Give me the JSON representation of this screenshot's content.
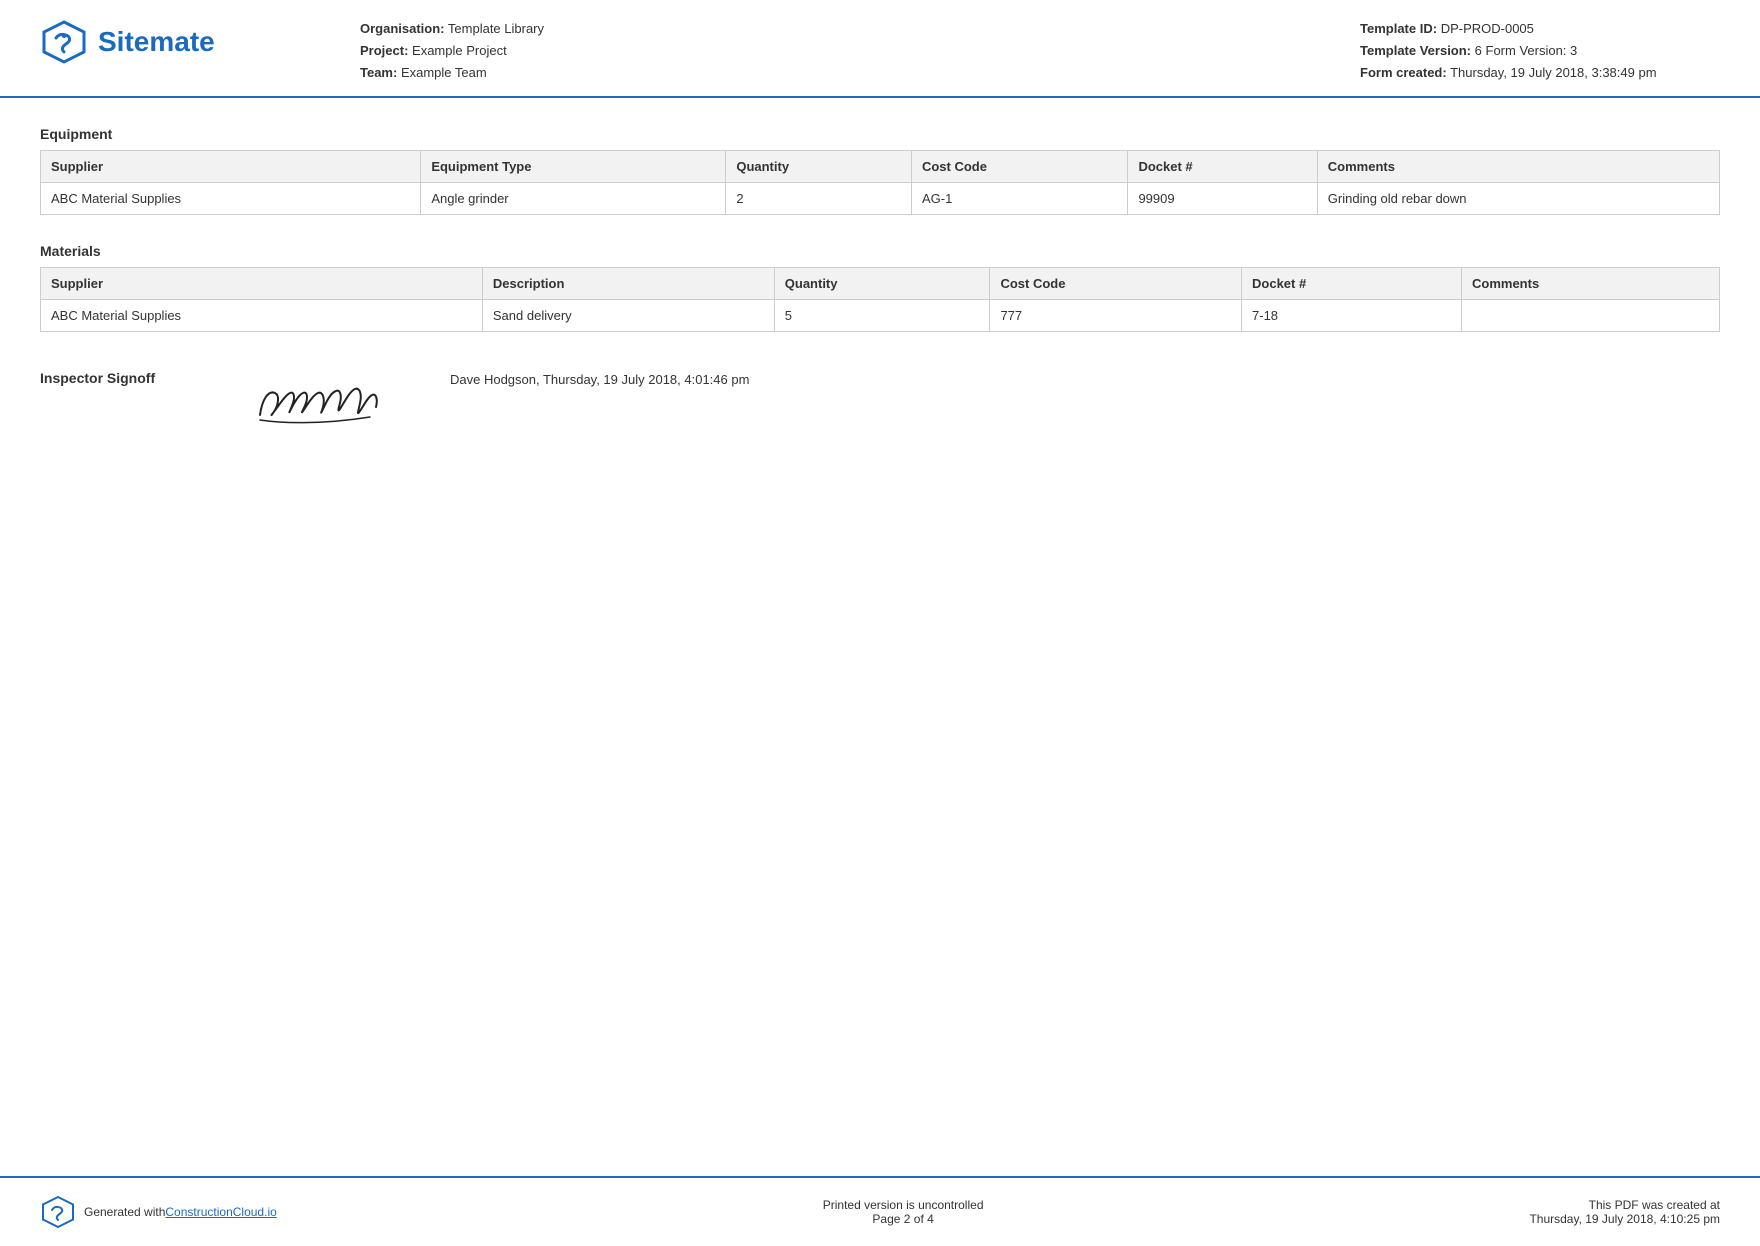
{
  "header": {
    "logo_text": "Sitemate",
    "org_label": "Organisation:",
    "org_value": "Template Library",
    "project_label": "Project:",
    "project_value": "Example Project",
    "team_label": "Team:",
    "team_value": "Example Team",
    "template_id_label": "Template ID:",
    "template_id_value": "DP-PROD-0005",
    "template_version_label": "Template Version:",
    "template_version_value": "6",
    "form_version_label": "Form Version:",
    "form_version_value": "3",
    "form_created_label": "Form created:",
    "form_created_value": "Thursday, 19 July 2018, 3:38:49 pm"
  },
  "equipment": {
    "section_title": "Equipment",
    "columns": [
      "Supplier",
      "Equipment Type",
      "Quantity",
      "Cost Code",
      "Docket #",
      "Comments"
    ],
    "rows": [
      {
        "supplier": "ABC Material Supplies",
        "equipment_type": "Angle grinder",
        "quantity": "2",
        "cost_code": "AG-1",
        "docket": "99909",
        "comments": "Grinding old rebar down"
      }
    ]
  },
  "materials": {
    "section_title": "Materials",
    "columns": [
      "Supplier",
      "Description",
      "Quantity",
      "Cost Code",
      "Docket #",
      "Comments"
    ],
    "rows": [
      {
        "supplier": "ABC Material Supplies",
        "description": "Sand delivery",
        "quantity": "5",
        "cost_code": "777",
        "docket": "7-18",
        "comments": ""
      }
    ]
  },
  "signoff": {
    "label": "Inspector Signoff",
    "info": "Dave Hodgson, Thursday, 19 July 2018, 4:01:46 pm"
  },
  "footer": {
    "generated_text": "Generated with ",
    "link_text": "ConstructionCloud.io",
    "uncontrolled": "Printed version is uncontrolled",
    "page_of": "Page 2 of 4",
    "pdf_created": "This PDF was created at",
    "pdf_created_date": "Thursday, 19 July 2018, 4:10:25 pm"
  }
}
